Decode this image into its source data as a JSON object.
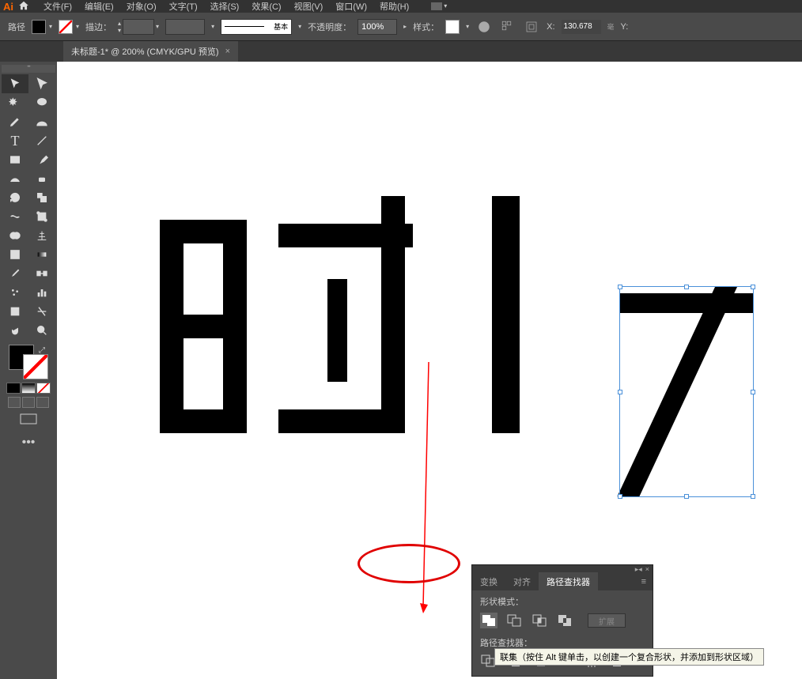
{
  "app": {
    "logo": "Ai"
  },
  "menus": [
    "文件(F)",
    "编辑(E)",
    "对象(O)",
    "文字(T)",
    "选择(S)",
    "效果(C)",
    "视图(V)",
    "窗口(W)",
    "帮助(H)"
  ],
  "controlBar": {
    "pathLabel": "路径",
    "strokeLabel": "描边：",
    "brushLabel": "基本",
    "opacityLabel": "不透明度：",
    "opacityValue": "100%",
    "styleLabel": "样式：",
    "xLabel": "X:",
    "xValue": "130.678",
    "yLabel": "Y:"
  },
  "tab": {
    "title": "未标题-1* @ 200% (CMYK/GPU 预览)",
    "close": "×"
  },
  "pathfinderPanel": {
    "tabs": [
      "变换",
      "对齐",
      "路径查找器"
    ],
    "activeTab": 2,
    "shapeModesLabel": "形状模式：",
    "pathfindersLabel": "路径查找器：",
    "expandLabel": "扩展",
    "menuIcon": "≡"
  },
  "tooltip": "联集（按住 Alt 键单击，以创建一个复合形状，并添加到形状区域）",
  "panelHeader": {
    "collapse": "▸◂",
    "close": "×"
  }
}
